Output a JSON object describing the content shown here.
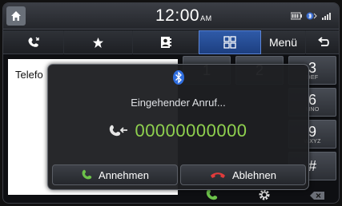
{
  "status": {
    "time": "12:00",
    "ampm": "AM"
  },
  "tabs": {
    "menu_label": "Menü"
  },
  "list": {
    "label": "Telefo"
  },
  "keypad": {
    "keys": [
      {
        "num": "1",
        "sub": ""
      },
      {
        "num": "2",
        "sub": ""
      },
      {
        "num": "3",
        "sub": "DEF"
      },
      {
        "num": "6",
        "sub": "MNO"
      },
      {
        "num": "9",
        "sub": "WXYZ"
      },
      {
        "num": "#",
        "sub": ""
      }
    ]
  },
  "popup": {
    "title": "Eingehender Anruf...",
    "number": "00000000000",
    "accept_label": "Annehmen",
    "decline_label": "Ablehnen"
  },
  "colors": {
    "accent_blue": "#2f5aa8",
    "number_green": "#8fd14f",
    "accept_green": "#6cc24a",
    "decline_red": "#e23b3b"
  }
}
